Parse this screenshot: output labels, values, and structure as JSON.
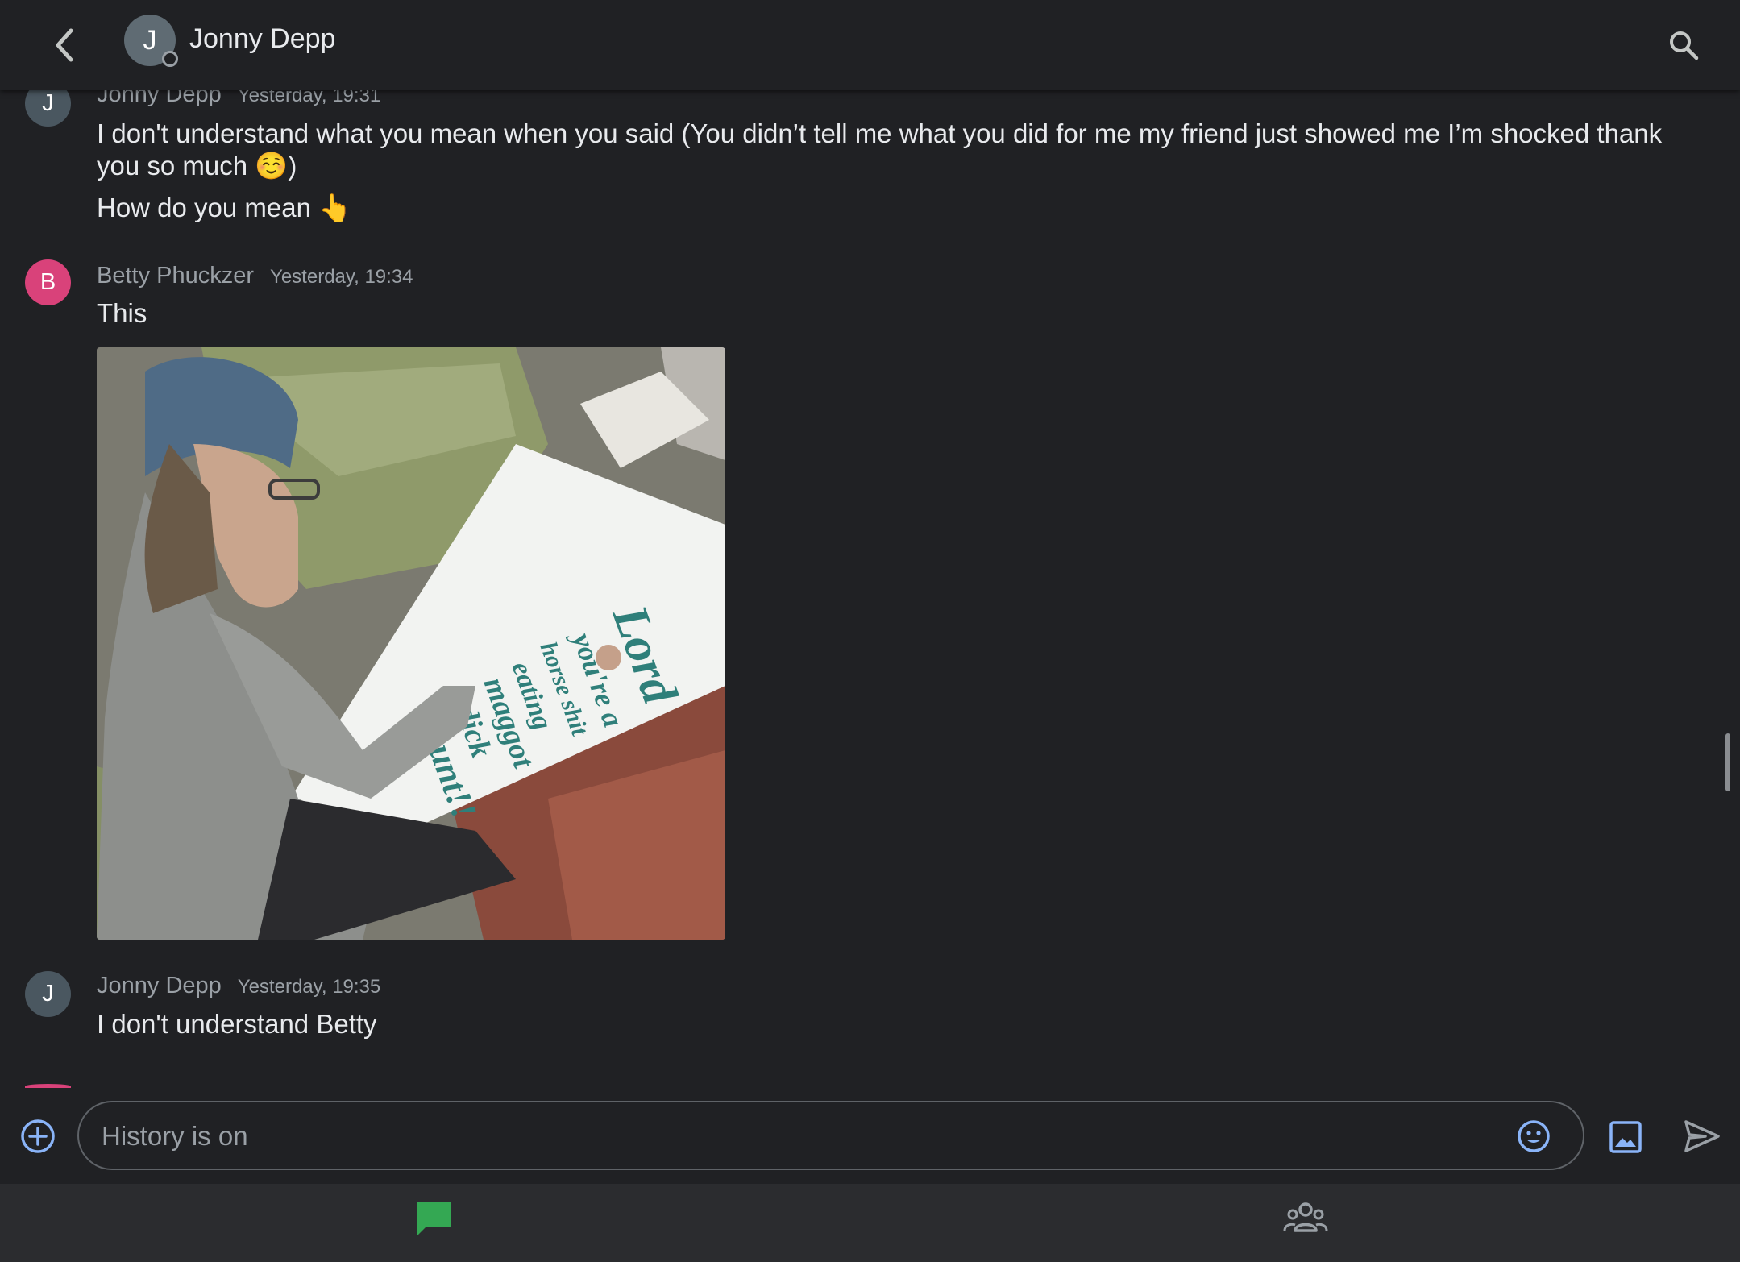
{
  "header": {
    "avatar_initial": "J",
    "title": "Jonny Depp",
    "back_icon": "chevron-left-icon",
    "search_icon": "search-icon"
  },
  "messages": [
    {
      "avatar_initial": "J",
      "sender": "Jonny Depp",
      "time": "Yesterday, 19:31",
      "texts": [
        "I don't understand what you mean when you said (You didn’t tell me what you did for me my friend just showed me I’m shocked thank you so much ☺️)",
        "How do you mean 👆"
      ]
    },
    {
      "avatar_initial": "B",
      "sender": "Betty Phuckzer",
      "time": "Yesterday, 19:34",
      "texts": [
        "This"
      ],
      "image": {
        "sign_text": [
          "Lord",
          "you're a",
          "horse shit",
          "eating",
          "maggot",
          "dick",
          "cunt!!"
        ]
      }
    },
    {
      "avatar_initial": "J",
      "sender": "Jonny Depp",
      "time": "Yesterday, 19:35",
      "texts": [
        "I don't understand Betty"
      ]
    }
  ],
  "composer": {
    "placeholder": "History is on",
    "add_icon": "add-circle-icon",
    "emoji_icon": "emoji-icon",
    "image_icon": "image-icon",
    "send_icon": "send-icon"
  },
  "bottom_nav": {
    "items": [
      {
        "icon": "chat-icon",
        "active": true
      },
      {
        "icon": "people-icon",
        "active": false
      }
    ]
  },
  "colors": {
    "background": "#202124",
    "accent_blue": "#8ab4f8",
    "active_green": "#34a853",
    "avatar_b": "#d9427a"
  }
}
